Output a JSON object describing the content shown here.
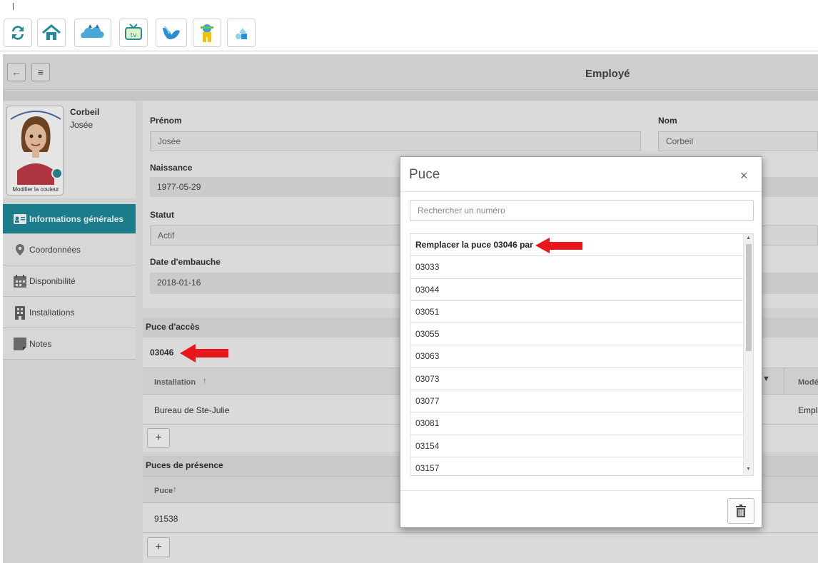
{
  "toolbar": {
    "buttons": [
      {
        "icon": "refresh-icon"
      },
      {
        "icon": "home-icon"
      },
      {
        "icon": "cloud-cat-icon"
      },
      {
        "icon": "tv-icon",
        "label": "tv"
      },
      {
        "icon": "bird-icon"
      },
      {
        "icon": "character-icon"
      },
      {
        "icon": "shapes-icon"
      }
    ]
  },
  "header": {
    "title": "Employé"
  },
  "profile": {
    "last_name": "Corbeil",
    "first_name": "Josée",
    "avatar_caption": "Modifier la couleur"
  },
  "nav": {
    "items": [
      {
        "label": "Informations générales",
        "active": true
      },
      {
        "label": "Coordonnées"
      },
      {
        "label": "Disponibilité"
      },
      {
        "label": "Installations"
      },
      {
        "label": "Notes"
      }
    ]
  },
  "form": {
    "prenom_label": "Prénom",
    "prenom_value": "Josée",
    "nom_label": "Nom",
    "nom_value": "Corbeil",
    "naissance_label": "Naissance",
    "naissance_value": "1977-05-29",
    "statut_label": "Statut",
    "statut_value": "Actif",
    "embauche_label": "Date d'embauche",
    "embauche_value": "2018-01-16"
  },
  "access_chip": {
    "heading": "Puce d'accès",
    "value": "03046",
    "grid_col_installation": "Installation",
    "grid_col_mode": "Modé",
    "row_installation": "Bureau de Ste-Julie",
    "row_mode": "Empl",
    "add_label": "+"
  },
  "presence_chips": {
    "heading": "Puces de présence",
    "grid_col_puce": "Puce",
    "row_value": "91538",
    "add_label": "+"
  },
  "modal": {
    "title": "Puce",
    "close_label": "×",
    "search_placeholder": "Rechercher un numéro",
    "replace_text": "Remplacer la puce 03046 par",
    "numbers": [
      "03033",
      "03044",
      "03051",
      "03055",
      "03063",
      "03073",
      "03077",
      "03081",
      "03154",
      "03157"
    ]
  },
  "colors": {
    "accent": "#1f8b9b",
    "arrow": "#e8171c"
  }
}
